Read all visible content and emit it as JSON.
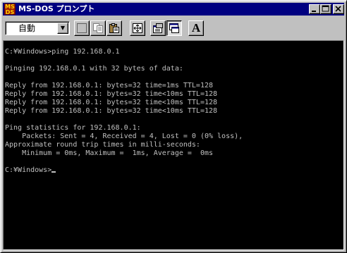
{
  "window": {
    "title": "MS-DOS プロンプト",
    "icon_label": "MS",
    "icon_label2": "DS"
  },
  "toolbar": {
    "font_size_value": "自動",
    "font_button_label": "A",
    "buttons": [
      "mark-icon",
      "copy-icon",
      "paste-icon",
      "fullscreen-icon",
      "properties-icon",
      "background-icon",
      "font-icon"
    ]
  },
  "console": {
    "lines": [
      "C:¥Windows>ping 192.168.0.1",
      "",
      "Pinging 192.168.0.1 with 32 bytes of data:",
      "",
      "Reply from 192.168.0.1: bytes=32 time=1ms TTL=128",
      "Reply from 192.168.0.1: bytes=32 time<10ms TTL=128",
      "Reply from 192.168.0.1: bytes=32 time<10ms TTL=128",
      "Reply from 192.168.0.1: bytes=32 time<10ms TTL=128",
      "",
      "Ping statistics for 192.168.0.1:",
      "    Packets: Sent = 4, Received = 4, Lost = 0 (0% loss),",
      "Approximate round trip times in milli-seconds:",
      "    Minimum = 0ms, Maximum =  1ms, Average =  0ms",
      ""
    ],
    "prompt": "C:¥Windows>"
  },
  "colors": {
    "title_bar": "#000080",
    "console_bg": "#000000",
    "console_text": "#c0c0c0",
    "window_face": "#c0c0c0"
  }
}
